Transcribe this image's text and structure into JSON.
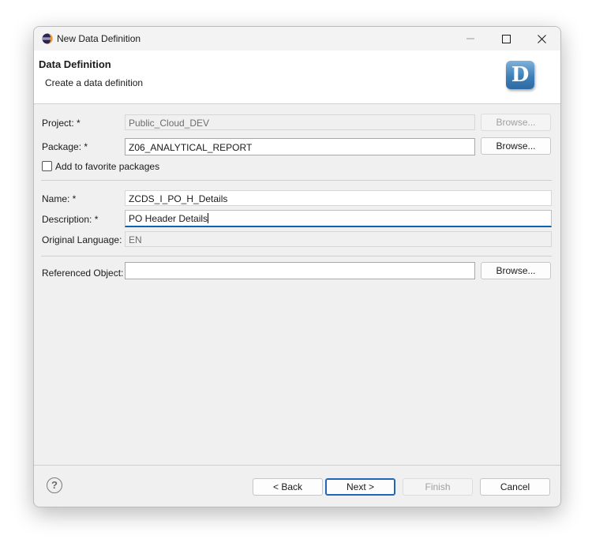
{
  "window": {
    "title": "New Data Definition",
    "icon": "eclipse-icon"
  },
  "banner": {
    "title": "Data Definition",
    "subtitle": "Create a data definition",
    "logo_letter": "D",
    "logo_color": "#3f7fb8"
  },
  "form": {
    "project": {
      "label": "Project: *",
      "value": "Public_Cloud_DEV",
      "browse": "Browse..."
    },
    "package": {
      "label": "Package: *",
      "value": "Z06_ANALYTICAL_REPORT",
      "browse": "Browse..."
    },
    "favorite": {
      "label": "Add to favorite packages",
      "checked": false
    },
    "name": {
      "label": "Name: *",
      "value": "ZCDS_I_PO_H_Details"
    },
    "description": {
      "label": "Description: *",
      "value": "PO Header Details"
    },
    "language": {
      "label": "Original Language:",
      "value": "EN"
    },
    "referenced": {
      "label": "Referenced Object:",
      "value": "",
      "browse": "Browse..."
    }
  },
  "buttons": {
    "help": "?",
    "back": "< Back",
    "next": "Next >",
    "finish": "Finish",
    "cancel": "Cancel"
  },
  "colors": {
    "focus_accent": "#0a64b4",
    "default_button_border": "#1f65b8"
  }
}
